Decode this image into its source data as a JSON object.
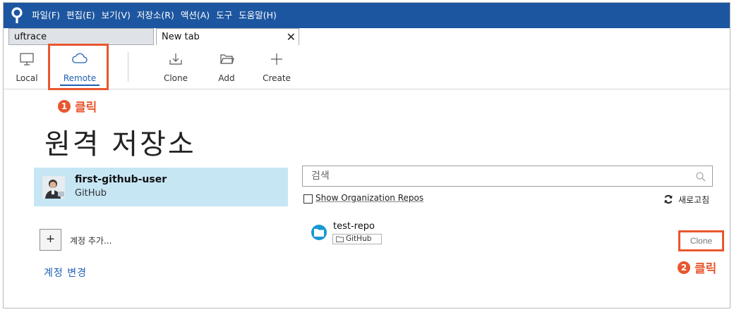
{
  "menu": [
    "파일(F)",
    "편집(E)",
    "보기(V)",
    "저장소(R)",
    "액션(A)",
    "도구",
    "도움말(H)"
  ],
  "tabs": [
    {
      "label": "uftrace"
    },
    {
      "label": "New tab"
    }
  ],
  "tab_close": "✕",
  "tab_add": "+",
  "toolbar": {
    "local": "Local",
    "remote": "Remote",
    "clone": "Clone",
    "add": "Add",
    "create": "Create"
  },
  "annotations": {
    "step1": {
      "num": "1",
      "text": "클릭"
    },
    "step2": {
      "num": "2",
      "text": "클릭"
    }
  },
  "page_title": "원격 저장소",
  "account": {
    "name": "first-github-user",
    "service": "GitHub"
  },
  "add_account": {
    "icon": "+",
    "label": "계정 추가..."
  },
  "switch_account": "계정 변경",
  "search": {
    "placeholder": "검색"
  },
  "org_repos_label": "Show Organization Repos",
  "refresh_label": "새로고침",
  "repo": {
    "name": "test-repo",
    "host": "GitHub",
    "clone_label": "Clone"
  },
  "colors": {
    "menubar": "#1d56a0",
    "accent": "#1f5fb4",
    "annotation": "#e9572f",
    "account_card": "#c6e6f4",
    "repo_icon": "#1898d4"
  }
}
